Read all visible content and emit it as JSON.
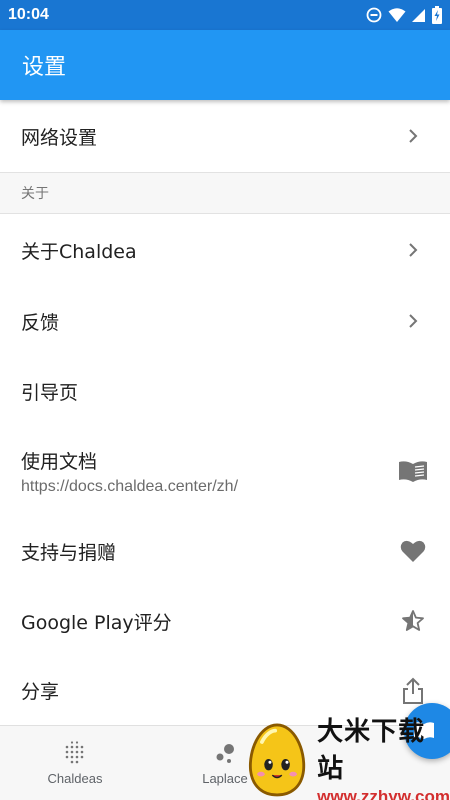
{
  "status_bar": {
    "time": "10:04",
    "icons": [
      "do-not-disturb-icon",
      "wifi-icon",
      "signal-icon",
      "battery-charging-icon"
    ]
  },
  "app_bar": {
    "title": "设置"
  },
  "settings": {
    "network": {
      "label": "网络设置",
      "icon": "chevron-right-icon"
    },
    "section_about": "关于",
    "about_chaldea": {
      "label": "关于Chaldea",
      "icon": "chevron-right-icon"
    },
    "feedback": {
      "label": "反馈",
      "icon": "chevron-right-icon"
    },
    "guide": {
      "label": "引导页"
    },
    "docs": {
      "label": "使用文档",
      "url": "https://docs.chaldea.center/zh/",
      "icon": "book-icon"
    },
    "support": {
      "label": "支持与捐赠",
      "icon": "heart-icon"
    },
    "rating": {
      "label": "Google Play评分",
      "icon": "star-half-icon"
    },
    "share": {
      "label": "分享",
      "icon": "share-icon"
    }
  },
  "bottom_nav": {
    "items": [
      {
        "label": "Chaldeas",
        "icon": "dots-grid-icon"
      },
      {
        "label": "Laplace",
        "icon": "bubbles-icon"
      }
    ]
  },
  "watermark": {
    "title": "大米下载站",
    "url": "www.zzhyw.com"
  },
  "colors": {
    "status_bar": "#1976d2",
    "app_bar": "#2196f3",
    "fab": "#1e88e5",
    "icon_gray": "#757575"
  }
}
